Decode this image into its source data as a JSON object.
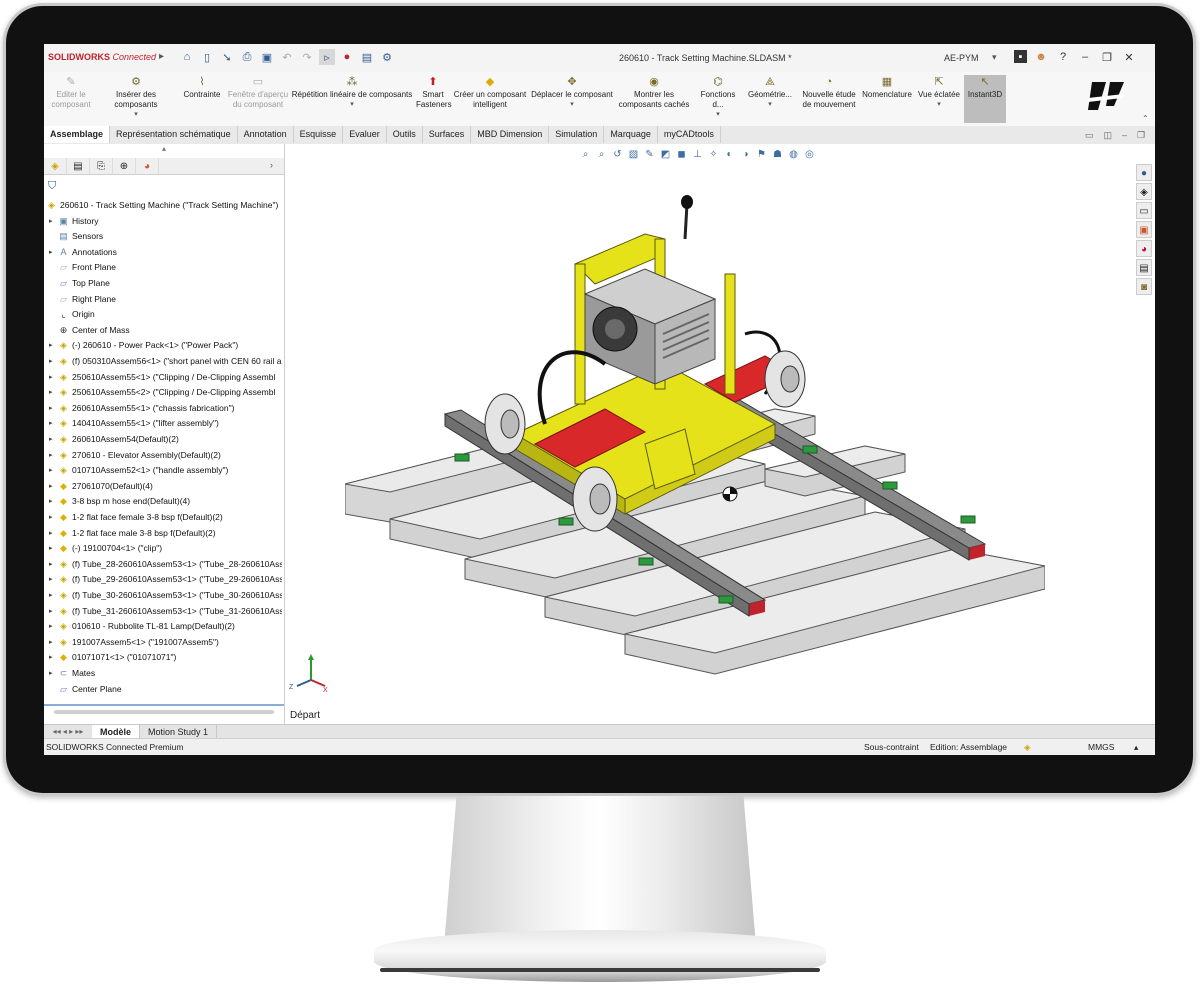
{
  "titlebar": {
    "brand": "SOLIDWORKS",
    "brand_suffix": "Connected",
    "document_title": "260610 - Track Setting Machine.SLDASM *",
    "user": "AE-PYM"
  },
  "ribbon": {
    "buttons": [
      {
        "label": "Editer le composant",
        "disabled": true
      },
      {
        "label": "Insérer des composants"
      },
      {
        "label": "Contrainte"
      },
      {
        "label": "Fenêtre d'aperçu du composant",
        "disabled": true
      },
      {
        "label": "Répétition linéaire de composants"
      },
      {
        "label": "Smart Fasteners"
      },
      {
        "label": "Créer un composant intelligent"
      },
      {
        "label": "Déplacer le composant"
      },
      {
        "label": "Montrer les composants cachés"
      },
      {
        "label": "Fonctions d..."
      },
      {
        "label": "Géométrie..."
      },
      {
        "label": "Nouvelle étude de mouvement"
      },
      {
        "label": "Nomenclature"
      },
      {
        "label": "Vue éclatée"
      },
      {
        "label": "Instant3D"
      }
    ]
  },
  "tabs": [
    "Assemblage",
    "Représentation schématique",
    "Annotation",
    "Esquisse",
    "Evaluer",
    "Outils",
    "Surfaces",
    "MBD Dimension",
    "Simulation",
    "Marquage",
    "myCADtools"
  ],
  "tree": [
    {
      "label": "260610 - Track Setting Machine (\"Track Setting Machine\")",
      "level": 0,
      "icon": "assembly-icon",
      "color": "#c8a400"
    },
    {
      "label": "History",
      "level": 1,
      "icon": "history-icon",
      "color": "#5b7fa8",
      "expand": true
    },
    {
      "label": "Sensors",
      "level": 1,
      "icon": "sensors-icon",
      "color": "#5b7fa8"
    },
    {
      "label": "Annotations",
      "level": 1,
      "icon": "annotations-icon",
      "color": "#5b7fa8",
      "expand": true
    },
    {
      "label": "Front Plane",
      "level": 1,
      "icon": "plane-icon",
      "color": "#8aaed6"
    },
    {
      "label": "Top Plane",
      "level": 1,
      "icon": "plane-icon",
      "color": "#5b86c8"
    },
    {
      "label": "Right Plane",
      "level": 1,
      "icon": "plane-icon",
      "color": "#8aaed6"
    },
    {
      "label": "Origin",
      "level": 1,
      "icon": "origin-icon",
      "color": "#333333"
    },
    {
      "label": "Center of Mass",
      "level": 1,
      "icon": "center-of-mass-icon",
      "color": "#333333"
    },
    {
      "label": "(-) 260610 - Power Pack<1> (\"Power Pack\")",
      "level": 1,
      "icon": "subassembly-icon",
      "color": "#c8a400",
      "expand": true
    },
    {
      "label": "(f) 050310Assem56<1> (\"short panel with CEN 60 rail a",
      "level": 1,
      "icon": "subassembly-icon",
      "color": "#c8a400",
      "expand": true
    },
    {
      "label": "250610Assem55<1> (\"Clipping / De-Clipping Assembl",
      "level": 1,
      "icon": "subassembly-icon",
      "color": "#c8a400",
      "expand": true
    },
    {
      "label": "250610Assem55<2> (\"Clipping / De-Clipping Assembl",
      "level": 1,
      "icon": "subassembly-icon",
      "color": "#c8a400",
      "expand": true
    },
    {
      "label": "260610Assem55<1> (\"chassis fabrication\")",
      "level": 1,
      "icon": "subassembly-icon",
      "color": "#c8a400",
      "expand": true
    },
    {
      "label": "140410Assem55<1> (\"lifter assembly\")",
      "level": 1,
      "icon": "subassembly-icon",
      "color": "#c8a400",
      "expand": true
    },
    {
      "label": "260610Assem54(Default)(2)",
      "level": 1,
      "icon": "subassembly-icon",
      "color": "#c8a400",
      "expand": true
    },
    {
      "label": "270610 - Elevator Assembly(Default)(2)",
      "level": 1,
      "icon": "subassembly-icon",
      "color": "#c8a400",
      "expand": true
    },
    {
      "label": "010710Assem52<1> (\"handle assembly\")",
      "level": 1,
      "icon": "subassembly-icon",
      "color": "#c8a400",
      "expand": true
    },
    {
      "label": "27061070(Default)(4)",
      "level": 1,
      "icon": "part-icon",
      "color": "#e0b000",
      "expand": true
    },
    {
      "label": "3-8 bsp m hose end(Default)(4)",
      "level": 1,
      "icon": "part-icon",
      "color": "#e0b000",
      "expand": true
    },
    {
      "label": "1-2 flat face female 3-8 bsp f(Default)(2)",
      "level": 1,
      "icon": "part-icon",
      "color": "#e0b000",
      "expand": true
    },
    {
      "label": "1-2 flat face male 3-8 bsp f(Default)(2)",
      "level": 1,
      "icon": "part-icon",
      "color": "#e0b000",
      "expand": true
    },
    {
      "label": "(-) 19100704<1> (\"clip\")",
      "level": 1,
      "icon": "part-icon",
      "color": "#e0b000",
      "expand": true
    },
    {
      "label": "(f) Tube_28-260610Assem53<1> (\"Tube_28-260610Ass",
      "level": 1,
      "icon": "subassembly-icon",
      "color": "#c8a400",
      "expand": true
    },
    {
      "label": "(f) Tube_29-260610Assem53<1> (\"Tube_29-260610Ass",
      "level": 1,
      "icon": "subassembly-icon",
      "color": "#c8a400",
      "expand": true
    },
    {
      "label": "(f) Tube_30-260610Assem53<1> (\"Tube_30-260610Ass",
      "level": 1,
      "icon": "subassembly-icon",
      "color": "#c8a400",
      "expand": true
    },
    {
      "label": "(f) Tube_31-260610Assem53<1> (\"Tube_31-260610Ass",
      "level": 1,
      "icon": "subassembly-icon",
      "color": "#c8a400",
      "expand": true
    },
    {
      "label": "010610 - Rubbolite TL-81 Lamp(Default)(2)",
      "level": 1,
      "icon": "subassembly-icon",
      "color": "#c8a400",
      "expand": true
    },
    {
      "label": "191007Assem5<1> (\"191007Assem5\")",
      "level": 1,
      "icon": "subassembly-icon",
      "color": "#c8a400",
      "expand": true
    },
    {
      "label": "01071071<1> (\"01071071\")",
      "level": 1,
      "icon": "part-icon",
      "color": "#e0b000",
      "expand": true
    },
    {
      "label": "Mates",
      "level": 1,
      "icon": "mates-icon",
      "color": "#5b7fa8",
      "expand": true
    },
    {
      "label": "Center Plane",
      "level": 1,
      "icon": "plane-icon",
      "color": "#5b86c8"
    }
  ],
  "viewport": {
    "depart_label": "Départ"
  },
  "bottom_tabs": [
    "Modèle",
    "Motion Study 1"
  ],
  "status": {
    "product": "SOLIDWORKS Connected Premium",
    "constraint": "Sous-contraint",
    "mode": "Edition: Assemblage",
    "units": "MMGS"
  },
  "colors": {
    "brand_red": "#c0232c",
    "machine_yellow": "#e6e21a",
    "rail_grey": "#6f6f6f",
    "sleeper_grey": "#d4d4d4"
  }
}
